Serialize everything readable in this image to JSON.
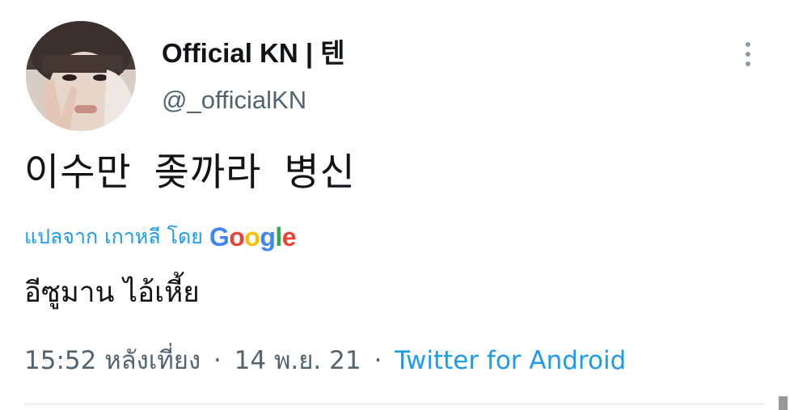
{
  "tweet": {
    "display_name": "Official KN | 텐",
    "handle": "@_officialKN",
    "text": "이수만 좆까라 병신",
    "translate_label": "แปลจาก เกาหลี โดย",
    "google_logo": [
      "G",
      "o",
      "o",
      "g",
      "l",
      "e"
    ],
    "translated_text": "อีซูมาน ไอ้เหี้ย",
    "time": "15:52 หลังเที่ยง",
    "date": "14 พ.ย. 21",
    "separator": "·",
    "source": "Twitter for Android"
  },
  "icons": {
    "more": "more-vertical-icon"
  },
  "colors": {
    "link": "#1d9bf0",
    "secondary_text": "#536471",
    "primary_text": "#0f1419",
    "google_blue": "#4285f4",
    "google_red": "#ea4335",
    "google_yellow": "#fbbc05",
    "google_green": "#34a853"
  }
}
